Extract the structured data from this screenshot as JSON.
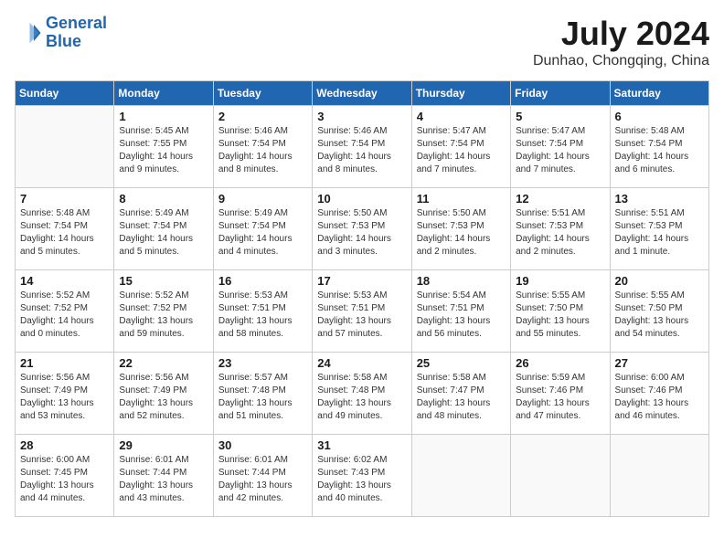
{
  "header": {
    "logo_line1": "General",
    "logo_line2": "Blue",
    "month_year": "July 2024",
    "location": "Dunhao, Chongqing, China"
  },
  "days_of_week": [
    "Sunday",
    "Monday",
    "Tuesday",
    "Wednesday",
    "Thursday",
    "Friday",
    "Saturday"
  ],
  "weeks": [
    [
      {
        "day": "",
        "text": ""
      },
      {
        "day": "1",
        "text": "Sunrise: 5:45 AM\nSunset: 7:55 PM\nDaylight: 14 hours\nand 9 minutes."
      },
      {
        "day": "2",
        "text": "Sunrise: 5:46 AM\nSunset: 7:54 PM\nDaylight: 14 hours\nand 8 minutes."
      },
      {
        "day": "3",
        "text": "Sunrise: 5:46 AM\nSunset: 7:54 PM\nDaylight: 14 hours\nand 8 minutes."
      },
      {
        "day": "4",
        "text": "Sunrise: 5:47 AM\nSunset: 7:54 PM\nDaylight: 14 hours\nand 7 minutes."
      },
      {
        "day": "5",
        "text": "Sunrise: 5:47 AM\nSunset: 7:54 PM\nDaylight: 14 hours\nand 7 minutes."
      },
      {
        "day": "6",
        "text": "Sunrise: 5:48 AM\nSunset: 7:54 PM\nDaylight: 14 hours\nand 6 minutes."
      }
    ],
    [
      {
        "day": "7",
        "text": "Sunrise: 5:48 AM\nSunset: 7:54 PM\nDaylight: 14 hours\nand 5 minutes."
      },
      {
        "day": "8",
        "text": "Sunrise: 5:49 AM\nSunset: 7:54 PM\nDaylight: 14 hours\nand 5 minutes."
      },
      {
        "day": "9",
        "text": "Sunrise: 5:49 AM\nSunset: 7:54 PM\nDaylight: 14 hours\nand 4 minutes."
      },
      {
        "day": "10",
        "text": "Sunrise: 5:50 AM\nSunset: 7:53 PM\nDaylight: 14 hours\nand 3 minutes."
      },
      {
        "day": "11",
        "text": "Sunrise: 5:50 AM\nSunset: 7:53 PM\nDaylight: 14 hours\nand 2 minutes."
      },
      {
        "day": "12",
        "text": "Sunrise: 5:51 AM\nSunset: 7:53 PM\nDaylight: 14 hours\nand 2 minutes."
      },
      {
        "day": "13",
        "text": "Sunrise: 5:51 AM\nSunset: 7:53 PM\nDaylight: 14 hours\nand 1 minute."
      }
    ],
    [
      {
        "day": "14",
        "text": "Sunrise: 5:52 AM\nSunset: 7:52 PM\nDaylight: 14 hours\nand 0 minutes."
      },
      {
        "day": "15",
        "text": "Sunrise: 5:52 AM\nSunset: 7:52 PM\nDaylight: 13 hours\nand 59 minutes."
      },
      {
        "day": "16",
        "text": "Sunrise: 5:53 AM\nSunset: 7:51 PM\nDaylight: 13 hours\nand 58 minutes."
      },
      {
        "day": "17",
        "text": "Sunrise: 5:53 AM\nSunset: 7:51 PM\nDaylight: 13 hours\nand 57 minutes."
      },
      {
        "day": "18",
        "text": "Sunrise: 5:54 AM\nSunset: 7:51 PM\nDaylight: 13 hours\nand 56 minutes."
      },
      {
        "day": "19",
        "text": "Sunrise: 5:55 AM\nSunset: 7:50 PM\nDaylight: 13 hours\nand 55 minutes."
      },
      {
        "day": "20",
        "text": "Sunrise: 5:55 AM\nSunset: 7:50 PM\nDaylight: 13 hours\nand 54 minutes."
      }
    ],
    [
      {
        "day": "21",
        "text": "Sunrise: 5:56 AM\nSunset: 7:49 PM\nDaylight: 13 hours\nand 53 minutes."
      },
      {
        "day": "22",
        "text": "Sunrise: 5:56 AM\nSunset: 7:49 PM\nDaylight: 13 hours\nand 52 minutes."
      },
      {
        "day": "23",
        "text": "Sunrise: 5:57 AM\nSunset: 7:48 PM\nDaylight: 13 hours\nand 51 minutes."
      },
      {
        "day": "24",
        "text": "Sunrise: 5:58 AM\nSunset: 7:48 PM\nDaylight: 13 hours\nand 49 minutes."
      },
      {
        "day": "25",
        "text": "Sunrise: 5:58 AM\nSunset: 7:47 PM\nDaylight: 13 hours\nand 48 minutes."
      },
      {
        "day": "26",
        "text": "Sunrise: 5:59 AM\nSunset: 7:46 PM\nDaylight: 13 hours\nand 47 minutes."
      },
      {
        "day": "27",
        "text": "Sunrise: 6:00 AM\nSunset: 7:46 PM\nDaylight: 13 hours\nand 46 minutes."
      }
    ],
    [
      {
        "day": "28",
        "text": "Sunrise: 6:00 AM\nSunset: 7:45 PM\nDaylight: 13 hours\nand 44 minutes."
      },
      {
        "day": "29",
        "text": "Sunrise: 6:01 AM\nSunset: 7:44 PM\nDaylight: 13 hours\nand 43 minutes."
      },
      {
        "day": "30",
        "text": "Sunrise: 6:01 AM\nSunset: 7:44 PM\nDaylight: 13 hours\nand 42 minutes."
      },
      {
        "day": "31",
        "text": "Sunrise: 6:02 AM\nSunset: 7:43 PM\nDaylight: 13 hours\nand 40 minutes."
      },
      {
        "day": "",
        "text": ""
      },
      {
        "day": "",
        "text": ""
      },
      {
        "day": "",
        "text": ""
      }
    ]
  ]
}
